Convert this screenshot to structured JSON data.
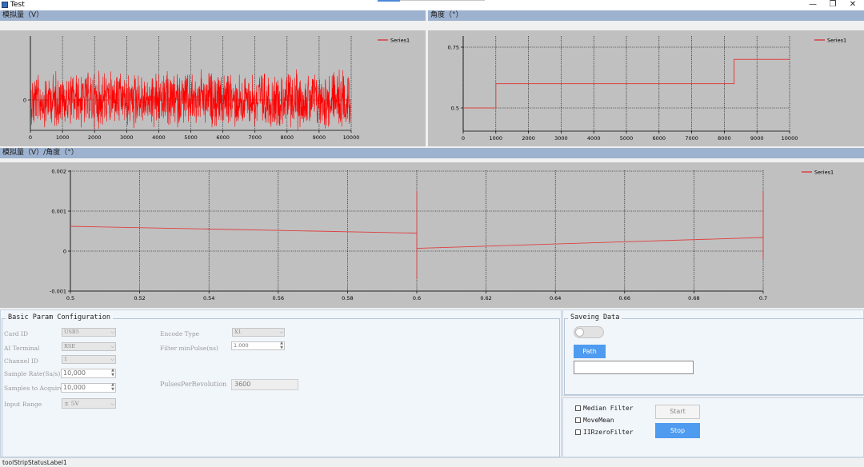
{
  "window": {
    "title": "Test",
    "minimize_glyph": "—",
    "restore_glyph": "❐",
    "close_glyph": "✕"
  },
  "charts": {
    "top_left": {
      "header": "模拟量（V）",
      "legend": "Series1"
    },
    "top_right": {
      "header": "角度（°）",
      "legend": "Series1"
    },
    "bottom": {
      "header": "模拟量（V）/角度（°）",
      "legend": "Series1"
    }
  },
  "chart_data": [
    {
      "type": "line",
      "series": [
        {
          "name": "Series1",
          "color": "#ff0000",
          "pattern": "dense noise oscillating around 0",
          "range": [
            -1,
            1
          ]
        }
      ],
      "xlim": [
        0,
        10000
      ],
      "xticks": [
        "0",
        "1000",
        "2000",
        "3000",
        "4000",
        "5000",
        "6000",
        "7000",
        "8000",
        "9000",
        "10000"
      ],
      "yticks": [
        "0"
      ],
      "grid": true,
      "legend_position": "top-right"
    },
    {
      "type": "line",
      "series": [
        {
          "name": "Series1",
          "color": "#e04040",
          "x": [
            0,
            1000,
            1000,
            8300,
            8300,
            10000
          ],
          "y": [
            0.5,
            0.5,
            0.6,
            0.6,
            0.7,
            0.7
          ]
        }
      ],
      "xlim": [
        0,
        10000
      ],
      "ylim": [
        0.45,
        0.8
      ],
      "xticks": [
        "0",
        "1000",
        "2000",
        "3000",
        "4000",
        "5000",
        "6000",
        "7000",
        "8000",
        "9000",
        "10000"
      ],
      "yticks": [
        "0.5",
        "0.75"
      ],
      "grid": true,
      "legend_position": "top-right"
    },
    {
      "type": "line",
      "series": [
        {
          "name": "Series1",
          "color": "#e04040",
          "x": [
            0.5,
            0.6,
            0.6,
            0.6,
            0.6,
            0.6,
            0.7,
            0.7,
            0.7
          ],
          "y": [
            0.00062,
            0.00045,
            0.0015,
            -0.0007,
            7e-05,
            7e-05,
            0.00034,
            -0.0002,
            0.0015
          ]
        }
      ],
      "xlim": [
        0.5,
        0.7
      ],
      "ylim": [
        -0.001,
        0.002
      ],
      "xticks": [
        "0.5",
        "0.52",
        "0.54",
        "0.56",
        "0.58",
        "0.6",
        "0.62",
        "0.64",
        "0.66",
        "0.68",
        "0.7"
      ],
      "yticks": [
        "0.002",
        "0.001",
        "0",
        "-0.001"
      ],
      "grid": true,
      "legend_position": "top-right"
    }
  ],
  "basic_params": {
    "title": "Basic Param Configuration",
    "card_id": {
      "label": "Card ID",
      "value": "USB5"
    },
    "ai_terminal": {
      "label": "AI Terminal",
      "value": "RSE"
    },
    "channel_id": {
      "label": "Channel ID",
      "value": "1"
    },
    "sample_rate": {
      "label": "Sample Rate(Sa/s)",
      "value": "10,000"
    },
    "samples_to_acquire": {
      "label": "Samples to Acquire",
      "value": "10,000"
    },
    "input_range": {
      "label": "Input Range",
      "value": "± 5V"
    },
    "encode_type": {
      "label": "Encode Type",
      "value": "X1"
    },
    "filter_min_pulse": {
      "label": "Filter minPulse(ns)",
      "value": "1.000"
    },
    "pulses_per_revolution": {
      "label": "PulsesPerRevolution",
      "value": "3600"
    }
  },
  "saving": {
    "title": "Saveing Data",
    "path_button": "Path",
    "path_value": ""
  },
  "filters": {
    "median": "Median Filter",
    "movemean": "MoveMean",
    "iirzero": "IIRzeroFilter",
    "start_button": "Start",
    "stop_button": "Stop"
  },
  "status": {
    "label": "toolStripStatusLabel1"
  }
}
